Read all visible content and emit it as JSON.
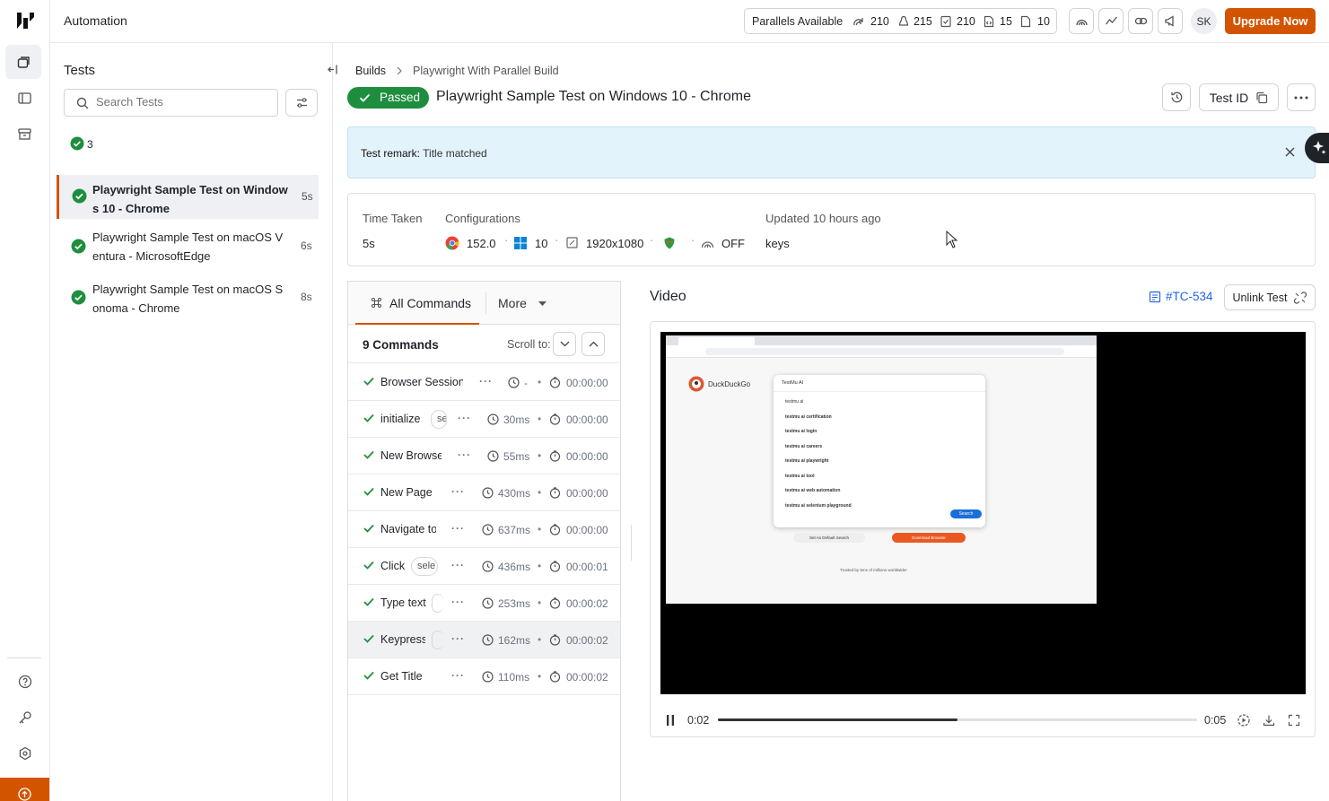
{
  "header": {
    "title": "Automation",
    "parallels_label": "Parallels Available",
    "parallels": [
      {
        "icon": "parallel-icon",
        "count": "210"
      },
      {
        "icon": "linux-icon",
        "count": "215"
      },
      {
        "icon": "checklist-icon",
        "count": "210"
      },
      {
        "icon": "document-code-icon",
        "count": "15"
      },
      {
        "icon": "document-icon",
        "count": "10"
      }
    ],
    "avatar_initials": "SK",
    "upgrade_label": "Upgrade Now"
  },
  "sidebar_panel": {
    "title": "Tests",
    "search_placeholder": "Search Tests",
    "passed_count": "3",
    "tests": [
      {
        "name": "Playwright Sample Test on Window s 10 - Chrome",
        "line1": "Playwright Sample Test on Window",
        "line2": "s 10 - Chrome",
        "duration": "5s",
        "selected": true
      },
      {
        "name": "Playwright Sample Test on macOS Ventura - MicrosoftEdge",
        "line1": "Playwright Sample Test on macOS V",
        "line2": "entura - MicrosoftEdge",
        "duration": "6s",
        "selected": false
      },
      {
        "name": "Playwright Sample Test on macOS Sonoma - Chrome",
        "line1": "Playwright Sample Test on macOS S",
        "line2": "onoma - Chrome",
        "duration": "8s",
        "selected": false
      }
    ]
  },
  "breadcrumb": {
    "root": "Builds",
    "current": "Playwright With Parallel Build"
  },
  "test": {
    "status": "Passed",
    "title": "Playwright Sample Test on Windows 10 - Chrome",
    "test_id_label": "Test ID",
    "remark_label": "Test remark:",
    "remark_value": "Title matched"
  },
  "summary": {
    "time_taken_label": "Time Taken",
    "time_taken": "5s",
    "configurations_label": "Configurations",
    "browser_version": "152.0",
    "os_version": "10",
    "resolution": "1920x1080",
    "tunnel": "OFF",
    "updated_label": "Updated 10 hours ago",
    "updated_value": "keys"
  },
  "commands": {
    "tab_all": "All Commands",
    "tab_more": "More",
    "count_label": "9 Commands",
    "scroll_label": "Scroll to:",
    "items": [
      {
        "name": "Browser Session !",
        "tag": "",
        "time": "-",
        "ts": "00:00:00"
      },
      {
        "name": "initialize",
        "tag": "se",
        "time": "30ms",
        "ts": "00:00:00"
      },
      {
        "name": "New Browser",
        "tag": "",
        "time": "55ms",
        "ts": "00:00:00"
      },
      {
        "name": "New Page",
        "tag": "",
        "time": "430ms",
        "ts": "00:00:00"
      },
      {
        "name": "Navigate to",
        "tag": "",
        "time": "637ms",
        "ts": "00:00:00"
      },
      {
        "name": "Click",
        "tag": "sele",
        "time": "436ms",
        "ts": "00:00:01"
      },
      {
        "name": "Type text",
        "tag": "",
        "time": "253ms",
        "ts": "00:00:02"
      },
      {
        "name": "Keypress",
        "tag": "",
        "time": "162ms",
        "ts": "00:00:02"
      },
      {
        "name": "Get Title",
        "tag": "",
        "time": "110ms",
        "ts": "00:00:02"
      }
    ]
  },
  "video": {
    "title": "Video",
    "test_case_link": "#TC-534",
    "unlink_label": "Unlink Test",
    "current_time": "0:02",
    "total_time": "0:05",
    "progress": 0.5,
    "screen": {
      "brand": "DuckDuckGo",
      "query": "TestMu AI",
      "suggestions": [
        "testmu ai",
        "testmu ai certification",
        "testmu ai login",
        "testmu ai careers",
        "testmu ai playwright",
        "testmu ai tool",
        "testmu ai web automation",
        "testmu ai selenium playground"
      ],
      "search_btn": "Search",
      "set_default": "Set As Default Search",
      "download": "Download Browser",
      "trusted": "Trusted by tens of millions worldwide!"
    }
  },
  "colors": {
    "accent": "#d35400",
    "success": "#1e8e3e",
    "link": "#2563eb",
    "remark_bg": "#e3f3fb"
  }
}
